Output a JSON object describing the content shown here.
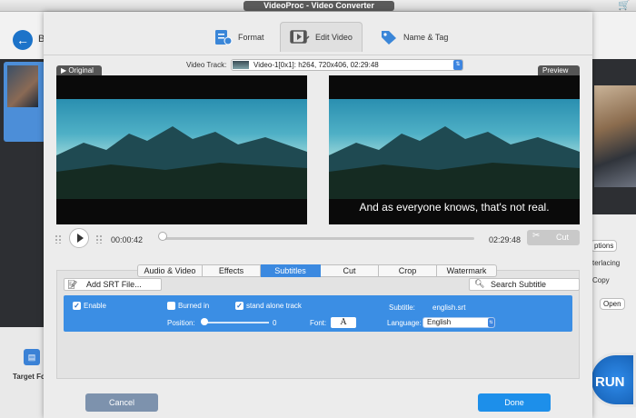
{
  "window": {
    "title": "VideoProc - Video Converter"
  },
  "background_app": {
    "back_label": "B",
    "target_format_label": "Target For",
    "right_panel": {
      "options_label": "ptions",
      "interlacing_label": "terlacing",
      "copy_label": "Copy",
      "open_label": "Open"
    },
    "run_label": "RUN"
  },
  "tabs": [
    {
      "label": "Format",
      "icon": "format-icon"
    },
    {
      "label": "Edit Video",
      "icon": "edit-video-icon",
      "active": true
    },
    {
      "label": "Name & Tag",
      "icon": "name-tag-icon"
    }
  ],
  "video_track": {
    "label": "Video Track:",
    "value": "Video-1[0x1]: h264, 720x406, 02:29:48"
  },
  "original_label": "Original",
  "preview_label": "Preview",
  "preview_subtitle": "And as everyone knows, that's not real.",
  "player": {
    "current_time": "00:00:42",
    "end_time": "02:29:48",
    "cut_label": "Cut"
  },
  "edit_tabs": [
    {
      "label": "Audio & Video"
    },
    {
      "label": "Effects"
    },
    {
      "label": "Subtitles",
      "active": true
    },
    {
      "label": "Cut"
    },
    {
      "label": "Crop"
    },
    {
      "label": "Watermark"
    }
  ],
  "subtitles": {
    "add_srt_label": "Add SRT File...",
    "search_label": "Search Subtitle",
    "enable_label": "Enable",
    "enable_checked": true,
    "burned_in_label": "Burned in",
    "burned_in_checked": false,
    "stand_alone_label": "stand alone track",
    "stand_alone_checked": true,
    "subtitle_label": "Subtitle:",
    "subtitle_value": "english.srt",
    "position_label": "Position:",
    "position_value": "0",
    "font_label": "Font:",
    "font_button": "A",
    "language_label": "Language:",
    "language_value": "English"
  },
  "buttons": {
    "cancel": "Cancel",
    "done": "Done"
  },
  "colors": {
    "accent": "#3b8ee4",
    "done": "#1d8fea",
    "cancel": "#7d92ad",
    "run": "#1f6fcf"
  }
}
